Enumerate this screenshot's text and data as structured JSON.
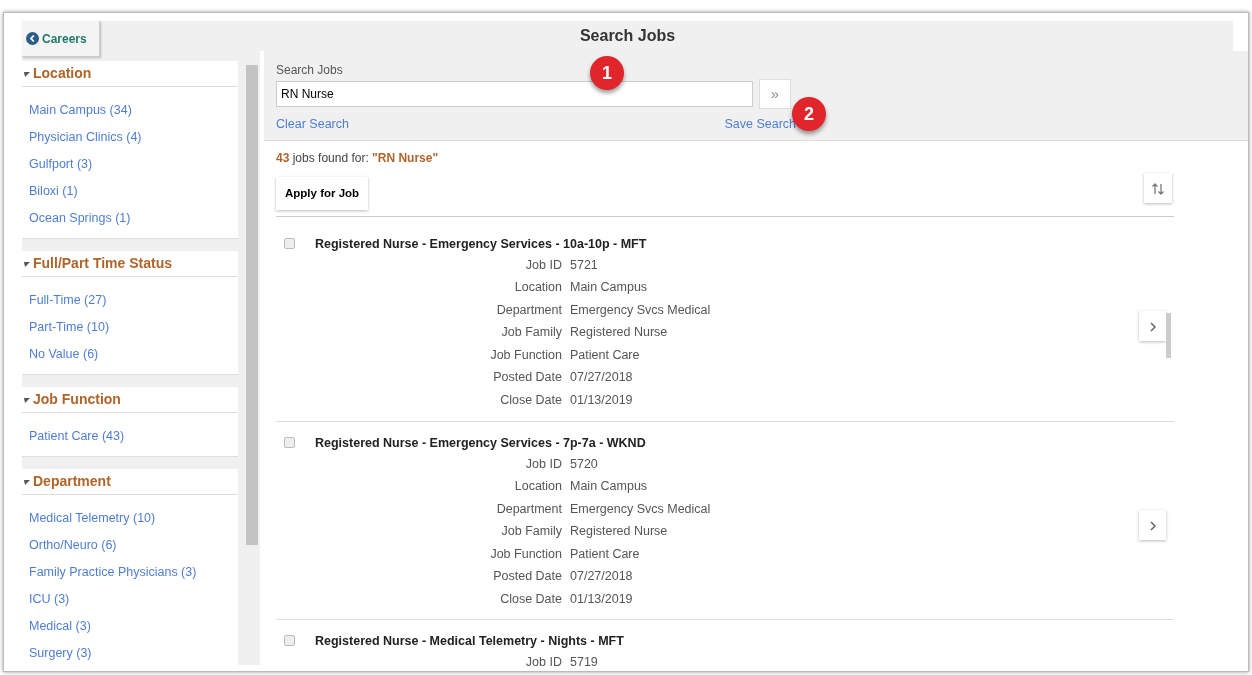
{
  "header": {
    "back_button": "Careers",
    "title": "Search Jobs"
  },
  "facets": [
    {
      "title": "Location",
      "expanded": true,
      "items": [
        "Main Campus (34)",
        "Physician Clinics (4)",
        "Gulfport (3)",
        "Biloxi (1)",
        "Ocean Springs (1)"
      ]
    },
    {
      "title": "Full/Part Time Status",
      "expanded": true,
      "items": [
        "Full-Time (27)",
        "Part-Time (10)",
        "No Value (6)"
      ]
    },
    {
      "title": "Job Function",
      "expanded": true,
      "items": [
        "Patient Care (43)"
      ]
    },
    {
      "title": "Department",
      "expanded": true,
      "items": [
        "Medical Telemetry (10)",
        "Ortho/Neuro (6)",
        "Family Practice Physicians (3)",
        "ICU (3)",
        "Medical (3)",
        "Surgery (3)"
      ]
    }
  ],
  "search": {
    "label": "Search Jobs",
    "value": "RN Nurse",
    "go_button": "»",
    "clear_link": "Clear Search",
    "save_link": "Save Search"
  },
  "callouts": [
    "1",
    "2"
  ],
  "results": {
    "count": "43",
    "text": " jobs found for: ",
    "query": "\"RN Nurse\"",
    "apply_button": "Apply for Job"
  },
  "jobs": [
    {
      "title": "Registered Nurse - Emergency Services - 10a-10p - MFT",
      "checked": false,
      "details": [
        {
          "label": "Job ID",
          "value": "5721"
        },
        {
          "label": "Location",
          "value": "Main Campus"
        },
        {
          "label": "Department",
          "value": "Emergency Svcs Medical"
        },
        {
          "label": "Job Family",
          "value": "Registered Nurse"
        },
        {
          "label": "Job Function",
          "value": "Patient Care"
        },
        {
          "label": "Posted Date",
          "value": "07/27/2018"
        },
        {
          "label": "Close Date",
          "value": "01/13/2019"
        }
      ]
    },
    {
      "title": "Registered Nurse - Emergency Services - 7p-7a - WKND",
      "checked": false,
      "details": [
        {
          "label": "Job ID",
          "value": "5720"
        },
        {
          "label": "Location",
          "value": "Main Campus"
        },
        {
          "label": "Department",
          "value": "Emergency Svcs Medical"
        },
        {
          "label": "Job Family",
          "value": "Registered Nurse"
        },
        {
          "label": "Job Function",
          "value": "Patient Care"
        },
        {
          "label": "Posted Date",
          "value": "07/27/2018"
        },
        {
          "label": "Close Date",
          "value": "01/13/2019"
        }
      ]
    },
    {
      "title": "Registered Nurse - Medical Telemetry - Nights - MFT",
      "checked": false,
      "details": [
        {
          "label": "Job ID",
          "value": "5719"
        }
      ]
    }
  ]
}
